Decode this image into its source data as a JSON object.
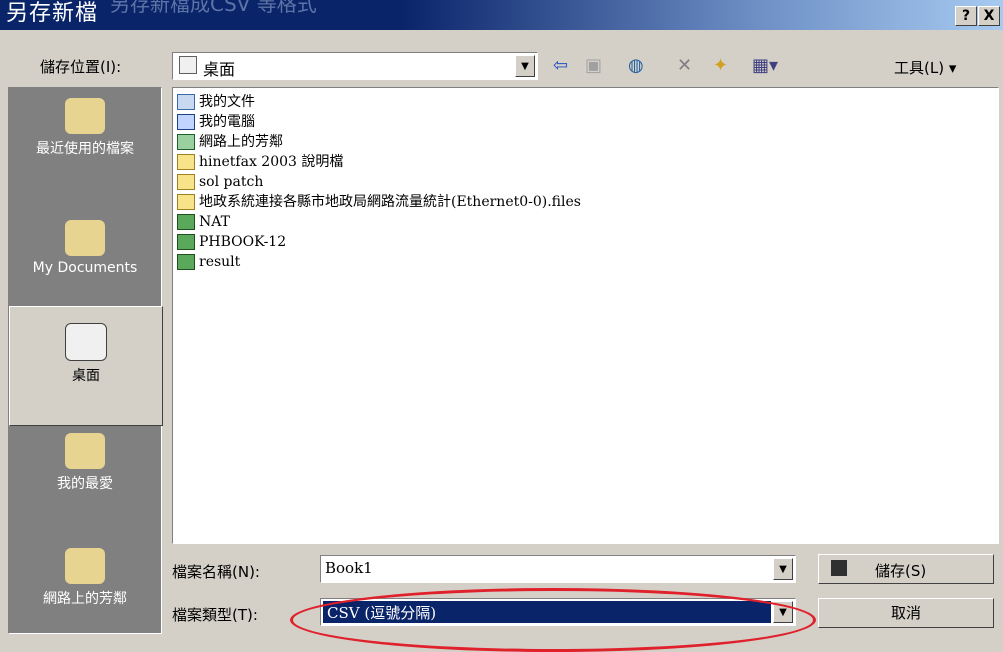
{
  "window": {
    "title": "另存新檔",
    "ghost_title": "另存新檔成CSV 等格式",
    "help_btn": "?",
    "close_btn": "X"
  },
  "save_in": {
    "label": "儲存位置(I):",
    "value": "桌面",
    "tools_label": "工具(L) ▾"
  },
  "places": [
    {
      "label": "最近使用的檔案",
      "icon": "history-icon"
    },
    {
      "label": "My Documents",
      "icon": "my-documents-icon"
    },
    {
      "label": "桌面",
      "icon": "desktop-icon",
      "selected": true
    },
    {
      "label": "我的最愛",
      "icon": "favorites-icon"
    },
    {
      "label": "網路上的芳鄰",
      "icon": "network-places-icon"
    }
  ],
  "files": [
    {
      "name": "我的文件",
      "type": "mydocs"
    },
    {
      "name": "我的電腦",
      "type": "mycomp"
    },
    {
      "name": "網路上的芳鄰",
      "type": "net"
    },
    {
      "name": "hinetfax 2003 說明檔",
      "type": "folder"
    },
    {
      "name": "sol patch",
      "type": "folder"
    },
    {
      "name": "地政系統連接各縣市地政局網路流量統計(Ethernet0-0).files",
      "type": "folder"
    },
    {
      "name": "NAT",
      "type": "xls"
    },
    {
      "name": "PHBOOK-12",
      "type": "xls"
    },
    {
      "name": "result",
      "type": "xls"
    }
  ],
  "filename": {
    "label": "檔案名稱(N):",
    "value": "Book1"
  },
  "filetype": {
    "label": "檔案類型(T):",
    "value": "CSV (逗號分隔)"
  },
  "buttons": {
    "save": "儲存(S)",
    "cancel": "取消"
  },
  "colors": {
    "title_bar": "#0a246a",
    "selection": "#0a246a",
    "highlight_oval": "#e0202a"
  }
}
